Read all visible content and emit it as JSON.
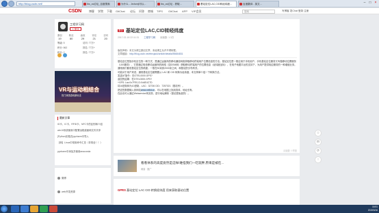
{
  "browser": {
    "address": "http://blog.csdn.net/",
    "tabs": [
      {
        "label": "lbs_cs论坛_百度搜索"
      },
      {
        "label": "为什么 - Jedrzeji可以..."
      },
      {
        "label": "lbs_cs论坛 - 获取..."
      },
      {
        "label": "基站定位LAC,CID转经纬度..."
      },
      {
        "label": "百度翻译 - 英文..."
      }
    ]
  },
  "csdn": {
    "logo": "CSDN",
    "nav": [
      "博客",
      "学院",
      "下载",
      "GitChat",
      "论坛",
      "问答",
      "商城",
      "TIPS",
      "GitChat",
      "APP",
      "VIP会员"
    ],
    "search_placeholder": "搜索",
    "right": "写博客  发Chat  登录  注册"
  },
  "profile": {
    "username": "工程学习网",
    "follow": "+ 关注",
    "stats": [
      {
        "label": "原创",
        "value": "19"
      },
      {
        "label": "粉丝",
        "value": "80"
      },
      {
        "label": "喜欢",
        "value": "29"
      },
      {
        "label": "评论",
        "value": "21"
      },
      {
        "label": "访问",
        "value": "20"
      }
    ],
    "stats2": [
      "等级: 5",
      "访问: 77万+",
      "积分: 862",
      "排名: 77万+",
      "积分: 2",
      "排名: 77万+"
    ]
  },
  "ad": {
    "title": "VR与运动相结合",
    "subtitle": "热门体感游戏新玩法"
  },
  "recent": {
    "title": "最新文章",
    "items": [
      "ID卡、IC卡、RFID卡、NFC卡的区别和介绍",
      "win10系统使用中配置远程桌面和文件共享",
      "[Python实现]在pycharm中导入",
      "【转】Linux中常用命令汇总（非常全！！）",
      "pycharm中添加并使用anaconda"
    ]
  },
  "side": {
    "items": [
      "微博",
      "web开发资源"
    ]
  },
  "article": {
    "badge": "原创",
    "title": "基站定位LAC,CID转经纬度",
    "date": "2017-02-18 22:11:31",
    "author": "工程学习网",
    "reads": "阅读数: 1.3万",
    "copyright": "版权声明：本文为博主原创文章，未经博主允许不得转载。",
    "copyright_link": "http://blog.csdn.net/elecjack/article/details/55684831",
    "copyright_note": "文章链接：",
    "para1": "基站定位是指手机定位的一种方式，是通过运营商的移动通信网络获取移动终端用户位置信息的方法。基站定位是一般应用于手机用户，手机基站定位服务又叫做移动位置服务（LBS服务），它是通过电信移动运营商的网络（如GSM网）获取移动终端用户的位置信息（经纬度坐标），在电子地图平台的支持下，为用户提供相应服务的一种增值业务。通常我们都说基站定位的精度，一般在50米到2000米之间，和基站的分布有关。",
    "para2": "可能对于用户来说，通常基站定位都需要从 LAC 和 CID 转换为经纬度，本文简单介绍一下转换方法。",
    "line1": "发送AT指令：在GTEL0000.GPS?",
    "line2": "返回的结果：在GTEL0000.GPS?",
    "line3": "+GPS: Lac:0x7FE0,Ci:0x6E4C7D",
    "line4": "将16进制转为10进制，LAC：32736 CID：7257021（基站号）。",
    "line5_pre": "把这些数据输入到网站",
    "line5_hl": "www.cellid.cn",
    "line5_post": "，可以在地图上找到具体，地址也有。",
    "line6_pre": "在此也可以通过Webservice来实现，",
    "line6_post": "进行地址解析（基站是免费的）。",
    "footer": "阅读数 ①举报"
  },
  "recommend": {
    "title": "看看体系的高度竟然是这样!难怪我们一吃就胖,原来是被在...",
    "meta": "网易 · 推广"
  },
  "comment": {
    "tag": "GPRS",
    "text": "基站定位 LAC CID 转换经纬度 用来获取基站位置"
  },
  "tools": [
    "☆",
    "✉",
    "⟳",
    "↑"
  ],
  "taskbar": {
    "time": "16:51",
    "date": "2019/3/16"
  }
}
